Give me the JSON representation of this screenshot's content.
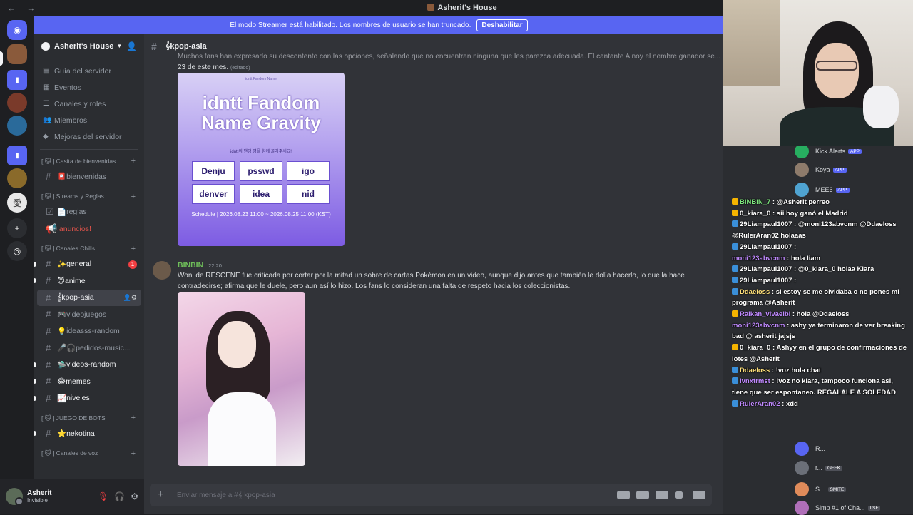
{
  "window": {
    "title": "Asherit's House"
  },
  "banner": {
    "text": "El modo Streamer está habilitado. Los nombres de usuario se han truncado.",
    "button": "Deshabilitar"
  },
  "server": {
    "name": "Asherit's House"
  },
  "sidebar": {
    "links": [
      {
        "label": "Guía del servidor"
      },
      {
        "label": "Eventos"
      },
      {
        "label": "Canales y roles"
      },
      {
        "label": "Miembros"
      },
      {
        "label": "Mejoras del servidor"
      }
    ],
    "categories": [
      {
        "label": "[ 🐱 ] Casita de bienvenidas",
        "channels": [
          {
            "label": "bienvenidas",
            "emoji": "📮"
          }
        ]
      },
      {
        "label": "[ 🐱 ] Streams y Reglas",
        "channels": [
          {
            "label": "reglas",
            "emoji": "📄"
          },
          {
            "label": "!anuncios!",
            "emoji": ""
          }
        ]
      },
      {
        "label": "[ 🐱 ] Canales Chills",
        "channels": [
          {
            "label": "general",
            "emoji": "✨",
            "badge": "1"
          },
          {
            "label": "anime",
            "emoji": "😈"
          },
          {
            "label": "kpop-asia",
            "emoji": "𝄞"
          },
          {
            "label": "videojuegos",
            "emoji": "🎮"
          },
          {
            "label": "ideasss-random",
            "emoji": "💡"
          },
          {
            "label": "pedidos-music...",
            "emoji": "🎤🎧"
          },
          {
            "label": "videos-random",
            "emoji": "🛸"
          },
          {
            "label": "memes",
            "emoji": "😂"
          },
          {
            "label": "niveles",
            "emoji": "📈"
          }
        ]
      },
      {
        "label": "[ 🐱 ] JUEGO DE BOTS",
        "channels": [
          {
            "label": "nekotina",
            "emoji": "⭐"
          }
        ]
      },
      {
        "label": "[ 🐱 ] Canales de voz",
        "channels": []
      }
    ]
  },
  "user": {
    "name": "Asherit",
    "status": "Invisible"
  },
  "channel": {
    "name": "kpop-asia"
  },
  "messages": {
    "first": {
      "top_text": "Muchos fans han expresado su descontento con las opciones, señalando que no encuentran ninguna que les parezca adecuada. El cantante Ainoy el nombre ganador se...",
      "tail": "23 de este mes.",
      "edited": "(editado)",
      "image": {
        "source": "idntt Fandom Name",
        "title_line1": "idntt Fandom",
        "title_line2": "Name Gravity",
        "subtitle": "idntt의 팬덤 명을 함께 골라주세요!",
        "options": [
          "Denju",
          "psswd",
          "igo",
          "denver",
          "idea",
          "nid"
        ],
        "schedule": "Schedule | 2026.08.23 11:00 ~ 2026.08.25 11:00 (KST)"
      }
    },
    "second": {
      "author": "BINBIN",
      "time": "22:20",
      "text": "Woni de RESCENE fue criticada por cortar por la mitad un sobre de cartas Pokémon en un video, aunque dijo antes que también le dolía hacerlo, lo que la hace contradecirse; afirma que le duele, pero aun así lo hizo. Los fans lo consideran una falta de respeto hacia los coleccionistas."
    }
  },
  "composer": {
    "placeholder": "Enviar mensaje a #𝄞 kpop-asia"
  },
  "members": [
    {
      "name": "Kick Alerts",
      "tag": "APP",
      "color": "#27ae60"
    },
    {
      "name": "Koya",
      "tag": "APP",
      "color": "#8e7b6b"
    },
    {
      "name": "MEE6",
      "tag": "APP",
      "color": "#4fa3d1"
    },
    {
      "name": "R...",
      "tag": "",
      "color": "#5865f2"
    },
    {
      "name": "r...",
      "tag": "GEEK",
      "color": "#6b6f78"
    },
    {
      "name": "S...",
      "tag": "SMITE",
      "color": "#e08b5a"
    },
    {
      "name": "Simp #1 of Cha...",
      "tag": "LSF",
      "color": "#b06fb9"
    }
  ],
  "chat": [
    {
      "user": "BINBIN_7",
      "color": "#7ee87e",
      "text": "@Asherit perreo"
    },
    {
      "user": "0_kiara_0",
      "color": "#ffffff",
      "text": "sii hoy ganó el Madrid"
    },
    {
      "user": "29Liampaul1007",
      "color": "#ffffff",
      "text": "@moni123abvcnm @Ddaeloss @RulerAran02 holaaas"
    },
    {
      "user": "29Liampaul1007",
      "color": "#ffffff",
      "text": ""
    },
    {
      "user": "moni123abvcnm",
      "color": "#c08aff",
      "text": "hola liam"
    },
    {
      "user": "29Liampaul1007",
      "color": "#ffffff",
      "text": "@0_kiara_0 holaa Kiara"
    },
    {
      "user": "29Liampaul1007",
      "color": "#ffffff",
      "text": ""
    },
    {
      "user": "Ddaeloss",
      "color": "#ffe07a",
      "text": "si estoy se me olvidaba o no pones mi programa @Asherit"
    },
    {
      "user": "Ralkan_vivaelbl",
      "color": "#c08aff",
      "text": "hola @Ddaeloss"
    },
    {
      "user": "moni123abvcnm",
      "color": "#c08aff",
      "text": "ashy ya terminaron de ver breaking bad @ asherit jajsjs"
    },
    {
      "user": "0_kiara_0",
      "color": "#ffffff",
      "text": "Ashyy en el grupo de confirmaciones de lotes @Asherit"
    },
    {
      "user": "Ddaeloss",
      "color": "#ffe07a",
      "text": "!voz hola chat"
    },
    {
      "user": "ivnxtrmst",
      "color": "#c08aff",
      "text": "!voz no kiara, tampoco funciona asi, tiene que ser espontaneo. REGALALE A SOLEDAD"
    },
    {
      "user": "RulerAran02",
      "color": "#c08aff",
      "text": "xdd"
    }
  ],
  "colors": {
    "accent": "#5865f2",
    "background": "#313338",
    "sidebar": "#2b2d31"
  }
}
